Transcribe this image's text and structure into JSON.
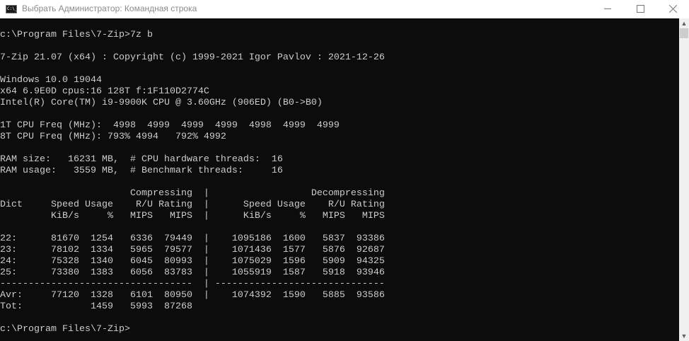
{
  "window": {
    "title": "Выбрать Администратор: Командная строка",
    "icon_label": "C:\\_",
    "icons": {
      "app": "cmd-icon",
      "minimize": "minimize-icon",
      "maximize": "maximize-icon",
      "close": "close-icon"
    }
  },
  "console": {
    "lines": [
      "",
      "c:\\Program Files\\7-Zip>7z b",
      "",
      "7-Zip 21.07 (x64) : Copyright (c) 1999-2021 Igor Pavlov : 2021-12-26",
      "",
      "Windows 10.0 19044",
      "x64 6.9E0D cpus:16 128T f:1F110D2774C",
      "Intel(R) Core(TM) i9-9900K CPU @ 3.60GHz (906ED) (B0->B0)",
      "",
      "1T CPU Freq (MHz):  4998  4999  4999  4999  4998  4999  4999",
      "8T CPU Freq (MHz): 793% 4994   792% 4992",
      "",
      "RAM size:   16231 MB,  # CPU hardware threads:  16",
      "RAM usage:   3559 MB,  # Benchmark threads:     16",
      "",
      "                       Compressing  |                  Decompressing",
      "Dict     Speed Usage    R/U Rating  |      Speed Usage    R/U Rating",
      "         KiB/s     %   MIPS   MIPS  |      KiB/s     %   MIPS   MIPS",
      "",
      "22:      81670  1254   6336  79449  |    1095186  1600   5837  93386",
      "23:      78102  1334   5965  79577  |    1071436  1577   5876  92687",
      "24:      75328  1340   6045  80993  |    1075029  1596   5909  94325",
      "25:      73380  1383   6056  83783  |    1055919  1587   5918  93946",
      "----------------------------------  | ------------------------------",
      "Avr:     77120  1328   6101  80950  |    1074392  1590   5885  93586",
      "Tot:            1459   5993  87268",
      "",
      "c:\\Program Files\\7-Zip>"
    ]
  },
  "scrollbar": {
    "up": "▲",
    "down": "▼"
  }
}
